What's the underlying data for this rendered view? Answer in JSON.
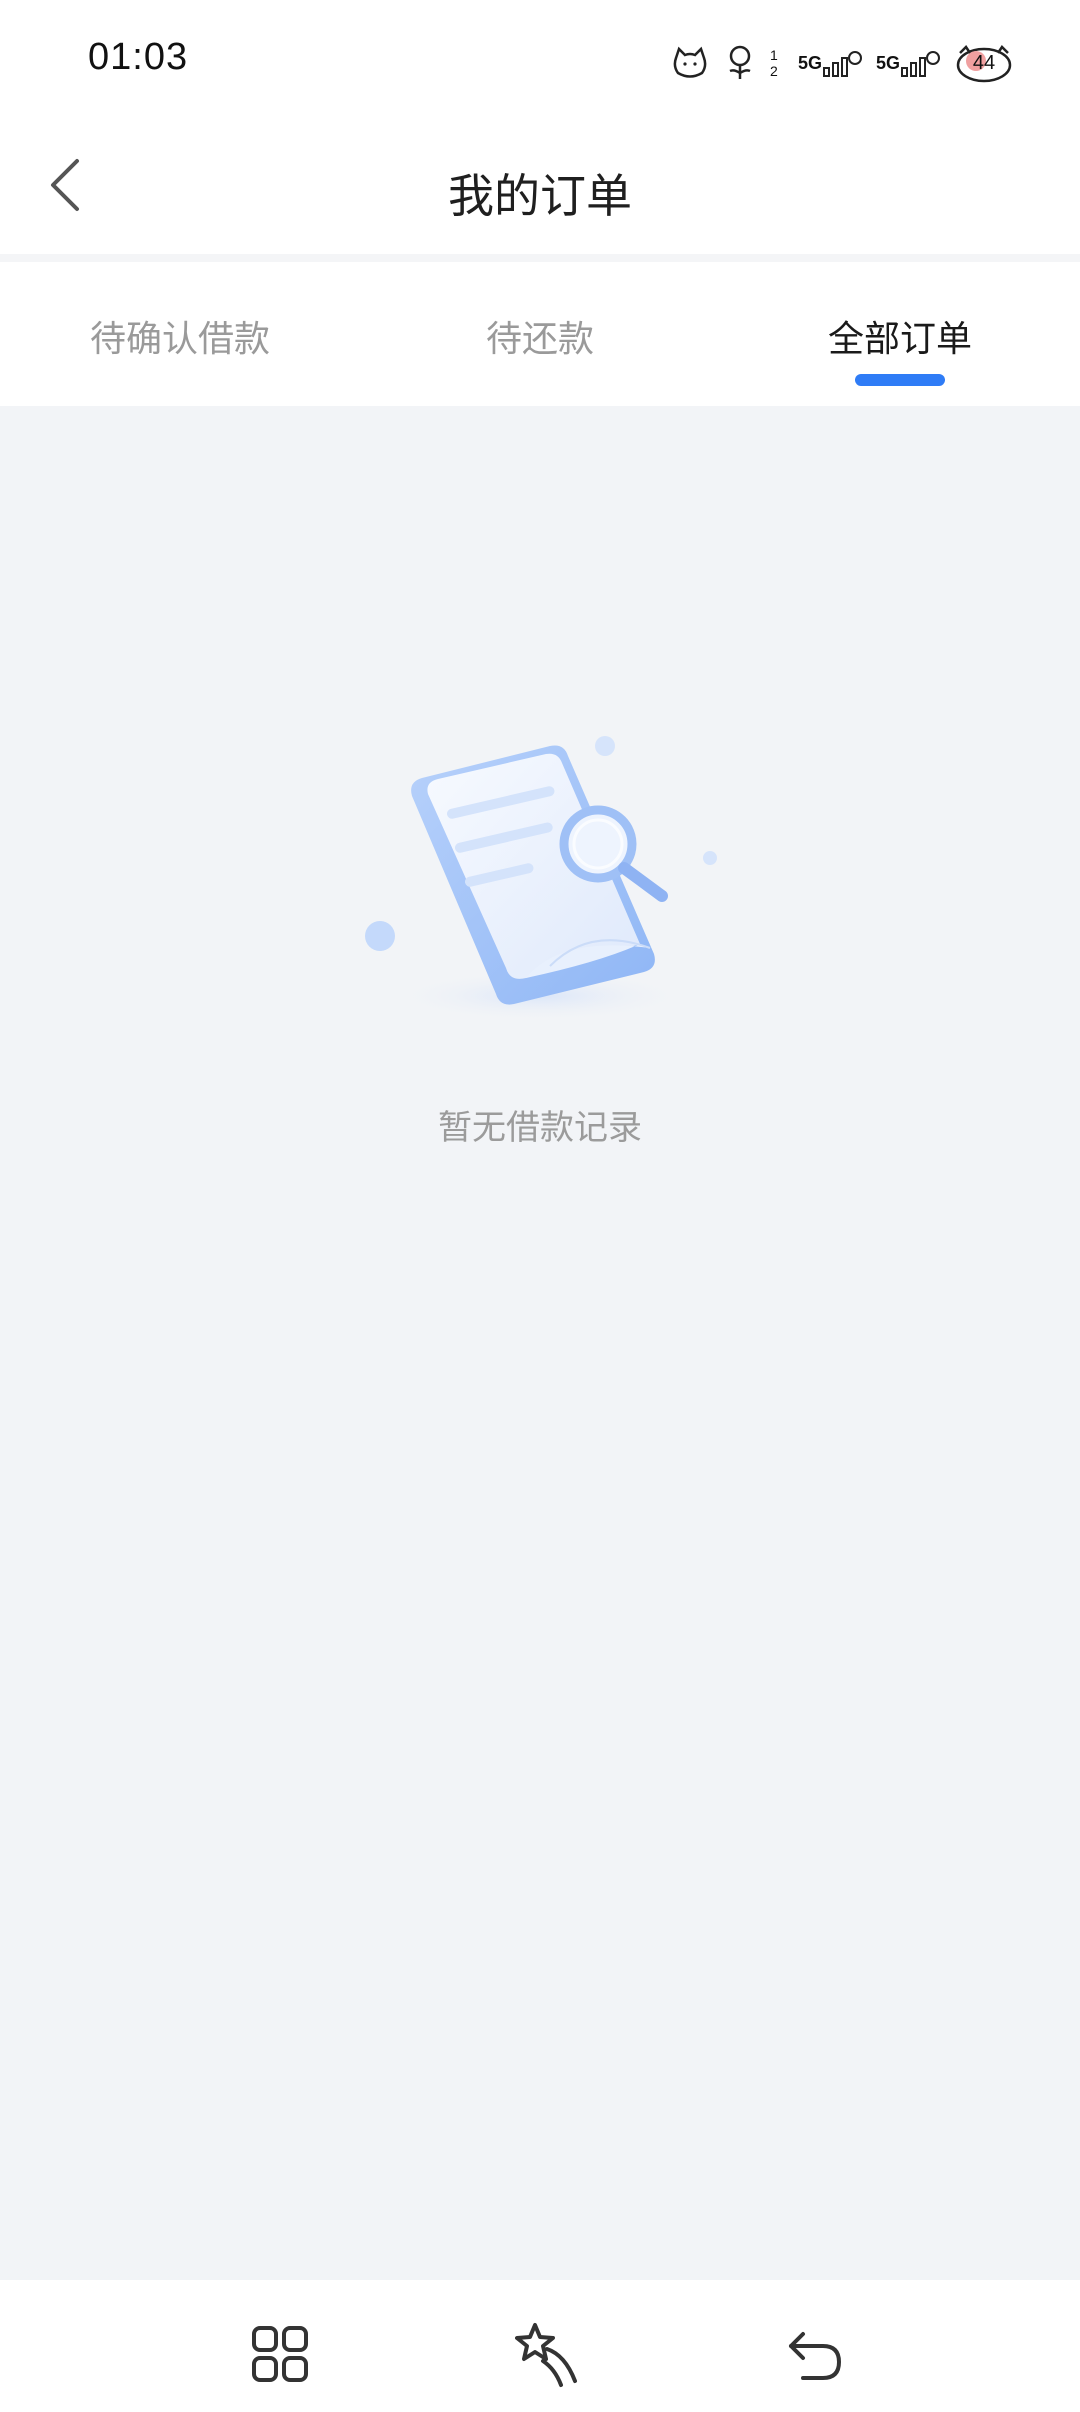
{
  "status_bar": {
    "time": "01:03",
    "network_1": "5G",
    "network_2": "5G",
    "battery": "44",
    "sim_slots": "1 2"
  },
  "nav": {
    "title": "我的订单",
    "back_icon": "chevron-left-icon"
  },
  "tabs": [
    {
      "label": "待确认借款",
      "active": false
    },
    {
      "label": "待还款",
      "active": false
    },
    {
      "label": "全部订单",
      "active": true
    }
  ],
  "empty_state": {
    "message": "暂无借款记录",
    "illustration": "document-search-illustration"
  },
  "system_nav": {
    "recents_icon": "grid-icon",
    "home_icon": "shooting-star-icon",
    "back_icon": "undo-arrow-icon"
  },
  "colors": {
    "accent": "#2f7cf6",
    "background": "#f2f4f7",
    "inactive_tab": "#9a9a9a"
  }
}
